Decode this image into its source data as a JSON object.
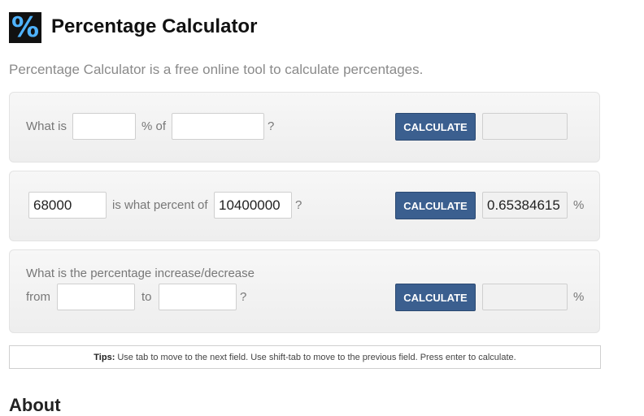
{
  "header": {
    "logo_symbol": "%",
    "title": "Percentage Calculator",
    "subtitle": "Percentage Calculator is a free online tool to calculate percentages."
  },
  "calc1": {
    "label_what_is": "What is",
    "label_percent_of": "% of",
    "label_question": "?",
    "input_percent": "",
    "input_of": "",
    "button_label": "CALCULATE",
    "result": ""
  },
  "calc2": {
    "input_value": "68000",
    "label_middle": "is what percent of",
    "input_total": "10400000",
    "label_question": "?",
    "button_label": "CALCULATE",
    "result": "0.65384615",
    "unit": "%"
  },
  "calc3": {
    "label_heading": "What is the percentage increase/decrease",
    "label_from": "from",
    "input_from": "",
    "label_to": "to",
    "input_to": "",
    "label_question": "?",
    "button_label": "CALCULATE",
    "result": "",
    "unit": "%"
  },
  "tips": {
    "label": "Tips:",
    "text": "Use tab to move to the next field. Use shift-tab to move to the previous field. Press enter to calculate."
  },
  "about": {
    "heading": "About"
  },
  "colors": {
    "button": "#3b5f8f",
    "logo_background": "#111111",
    "logo_symbol": "#4fb3ff"
  }
}
